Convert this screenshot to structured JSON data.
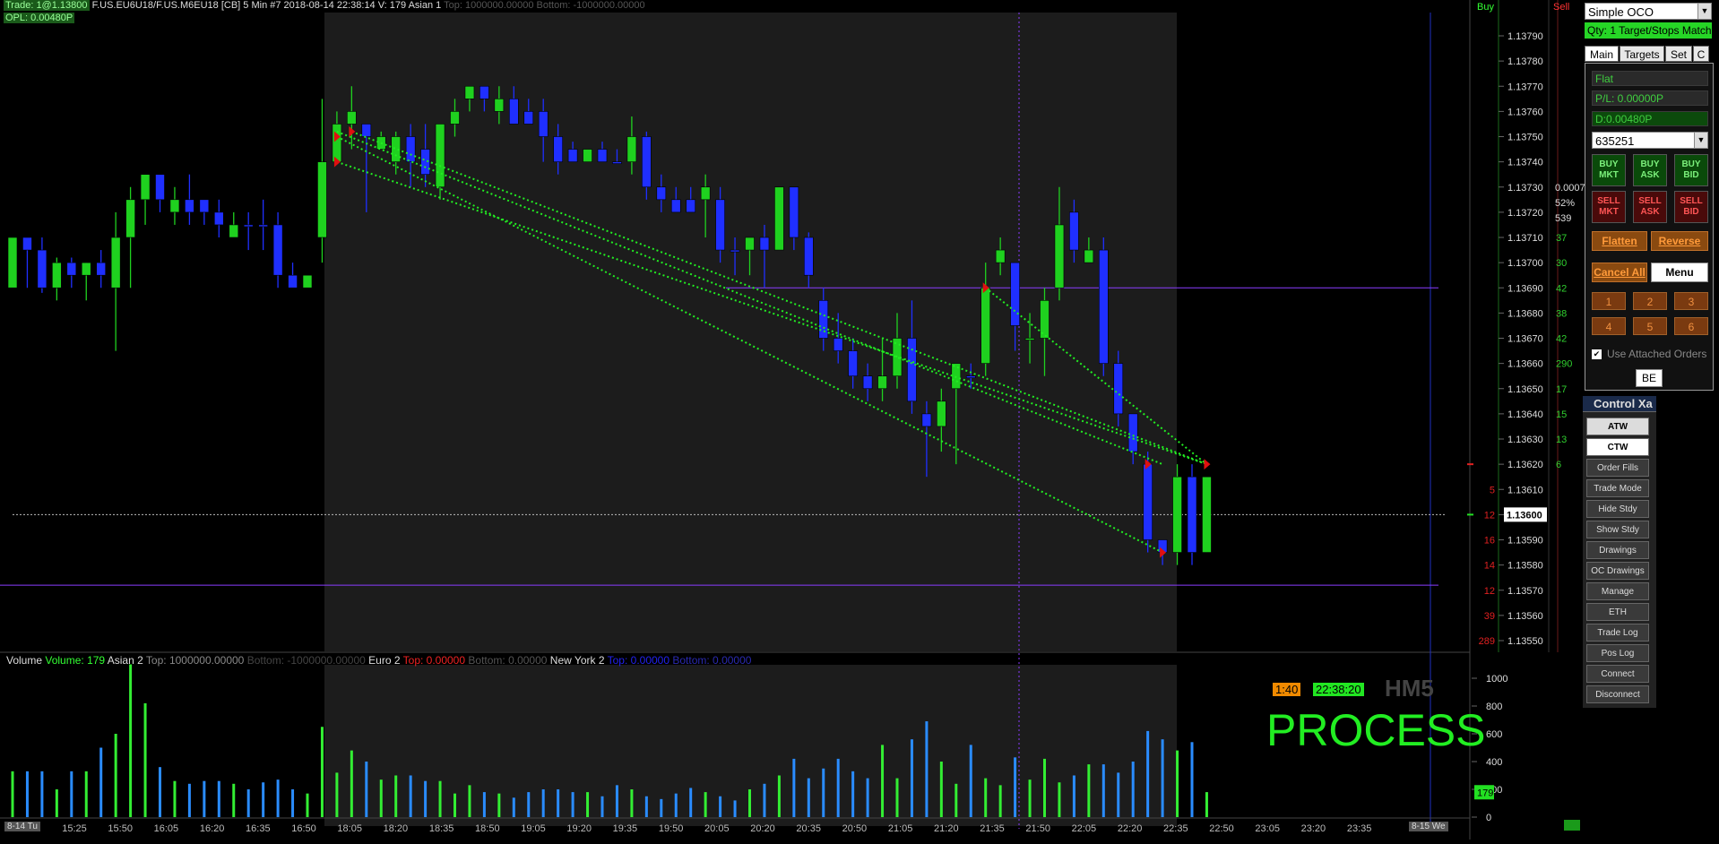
{
  "header": {
    "trade_label": "Trade: 1@1.13800",
    "symbol_info": "F.US.EU6U18/F.US.M6EU18 [CB]  5 Min   #7 2018-08-14 22:38:14 V: 179 Asian 1",
    "top_label": "Top: 1000000.00000",
    "bottom_label": "Bottom: -1000000.00000",
    "opl_label": "OPL: 0.00480P"
  },
  "price_axis": {
    "ticks": [
      "1.13790",
      "1.13780",
      "1.13770",
      "1.13760",
      "1.13750",
      "1.13740",
      "1.13730",
      "1.13720",
      "1.13710",
      "1.13700",
      "1.13690",
      "1.13680",
      "1.13670",
      "1.13660",
      "1.13650",
      "1.13640",
      "1.13630",
      "1.13620",
      "1.13610",
      "1.13600",
      "1.13590",
      "1.13580",
      "1.13570",
      "1.13560",
      "1.13550"
    ],
    "current_price": "1.13600"
  },
  "dom": {
    "buy_header": "Buy",
    "sell_header": "Sell",
    "bid_sizes": [
      "5",
      "12",
      "16",
      "14",
      "12",
      "39",
      "289"
    ],
    "ask_sizes": [
      "37",
      "30",
      "42",
      "38",
      "42",
      "290",
      "17",
      "15",
      "13",
      "6"
    ],
    "stats": [
      "0.0007",
      "52%",
      "539"
    ]
  },
  "volume_pane": {
    "label": "Volume",
    "volume_value": "Volume: 179",
    "asian2": "Asian 2",
    "asian2_top": "Top: 1000000.00000",
    "asian2_bottom": "Bottom: -1000000.00000",
    "euro2": "Euro 2",
    "euro2_top": "Top: 0.00000",
    "euro2_bottom": "Bottom: 0.00000",
    "ny2": "New York 2",
    "ny2_top": "Top: 0.00000",
    "ny2_bottom": "Bottom: 0.00000",
    "axis_ticks": [
      "1000",
      "800",
      "600",
      "400",
      "200",
      "0"
    ],
    "current_volume": "179",
    "timer": "1:40",
    "clock": "22:38:20",
    "bar_type": "HM5",
    "status_text": "PROCESS"
  },
  "time_axis": {
    "ticks": [
      "15:25",
      "15:50",
      "16:05",
      "16:20",
      "16:35",
      "16:50",
      "18:05",
      "18:20",
      "18:35",
      "18:50",
      "19:05",
      "19:20",
      "19:35",
      "19:50",
      "20:05",
      "20:20",
      "20:35",
      "20:50",
      "21:05",
      "21:20",
      "21:35",
      "21:50",
      "22:05",
      "22:20",
      "22:35",
      "22:50",
      "23:05",
      "23:20",
      "23:35"
    ],
    "left_date": "8-14 Tu",
    "right_date": "8-15 We"
  },
  "chart_data": {
    "type": "candlestick",
    "instrument": "F.US.EU6U18/F.US.M6EU18",
    "interval": "5 Min",
    "ylim": [
      1.13545,
      1.13795
    ],
    "candles": [
      {
        "o": 1.1369,
        "h": 1.1371,
        "l": 1.1369,
        "c": 1.1371,
        "col": "g"
      },
      {
        "o": 1.1371,
        "h": 1.1371,
        "l": 1.1369,
        "c": 1.13705,
        "col": "b"
      },
      {
        "o": 1.13705,
        "h": 1.1371,
        "l": 1.13688,
        "c": 1.1369,
        "col": "b"
      },
      {
        "o": 1.1369,
        "h": 1.13702,
        "l": 1.13685,
        "c": 1.137,
        "col": "g"
      },
      {
        "o": 1.137,
        "h": 1.13702,
        "l": 1.1369,
        "c": 1.13695,
        "col": "b"
      },
      {
        "o": 1.13695,
        "h": 1.137,
        "l": 1.13685,
        "c": 1.137,
        "col": "g"
      },
      {
        "o": 1.137,
        "h": 1.13705,
        "l": 1.1369,
        "c": 1.13695,
        "col": "b"
      },
      {
        "o": 1.1369,
        "h": 1.1372,
        "l": 1.13665,
        "c": 1.1371,
        "col": "g"
      },
      {
        "o": 1.1371,
        "h": 1.1373,
        "l": 1.1369,
        "c": 1.13725,
        "col": "g"
      },
      {
        "o": 1.13725,
        "h": 1.13735,
        "l": 1.13715,
        "c": 1.13735,
        "col": "g"
      },
      {
        "o": 1.13735,
        "h": 1.13735,
        "l": 1.1372,
        "c": 1.13725,
        "col": "b"
      },
      {
        "o": 1.13725,
        "h": 1.1373,
        "l": 1.13715,
        "c": 1.1372,
        "col": "g"
      },
      {
        "o": 1.1372,
        "h": 1.13735,
        "l": 1.13715,
        "c": 1.13725,
        "col": "b"
      },
      {
        "o": 1.13725,
        "h": 1.13725,
        "l": 1.13715,
        "c": 1.1372,
        "col": "b"
      },
      {
        "o": 1.1372,
        "h": 1.13725,
        "l": 1.1371,
        "c": 1.13715,
        "col": "b"
      },
      {
        "o": 1.1371,
        "h": 1.1372,
        "l": 1.1371,
        "c": 1.13715,
        "col": "g"
      },
      {
        "o": 1.13715,
        "h": 1.1372,
        "l": 1.13705,
        "c": 1.13715,
        "col": "b"
      },
      {
        "o": 1.13715,
        "h": 1.13725,
        "l": 1.13705,
        "c": 1.13715,
        "col": "b"
      },
      {
        "o": 1.13715,
        "h": 1.1372,
        "l": 1.1369,
        "c": 1.13695,
        "col": "b"
      },
      {
        "o": 1.13695,
        "h": 1.137,
        "l": 1.1369,
        "c": 1.1369,
        "col": "b"
      },
      {
        "o": 1.1369,
        "h": 1.13695,
        "l": 1.1369,
        "c": 1.13695,
        "col": "g"
      },
      {
        "o": 1.1371,
        "h": 1.13765,
        "l": 1.137,
        "c": 1.1374,
        "col": "g"
      },
      {
        "o": 1.1374,
        "h": 1.1376,
        "l": 1.1374,
        "c": 1.13755,
        "col": "g"
      },
      {
        "o": 1.13755,
        "h": 1.1377,
        "l": 1.13745,
        "c": 1.1376,
        "col": "g"
      },
      {
        "o": 1.13755,
        "h": 1.13755,
        "l": 1.1372,
        "c": 1.1375,
        "col": "b"
      },
      {
        "o": 1.1375,
        "h": 1.13752,
        "l": 1.13745,
        "c": 1.13745,
        "col": "g"
      },
      {
        "o": 1.1374,
        "h": 1.13752,
        "l": 1.13735,
        "c": 1.1375,
        "col": "g"
      },
      {
        "o": 1.1375,
        "h": 1.13755,
        "l": 1.1373,
        "c": 1.1374,
        "col": "b"
      },
      {
        "o": 1.13735,
        "h": 1.13755,
        "l": 1.1373,
        "c": 1.13745,
        "col": "b"
      },
      {
        "o": 1.1373,
        "h": 1.13755,
        "l": 1.13725,
        "c": 1.13755,
        "col": "g"
      },
      {
        "o": 1.13755,
        "h": 1.13765,
        "l": 1.1375,
        "c": 1.1376,
        "col": "g"
      },
      {
        "o": 1.13765,
        "h": 1.1377,
        "l": 1.1376,
        "c": 1.1377,
        "col": "g"
      },
      {
        "o": 1.1377,
        "h": 1.1377,
        "l": 1.1376,
        "c": 1.13765,
        "col": "b"
      },
      {
        "o": 1.13765,
        "h": 1.1377,
        "l": 1.13755,
        "c": 1.1376,
        "col": "g"
      },
      {
        "o": 1.13765,
        "h": 1.1377,
        "l": 1.13755,
        "c": 1.13755,
        "col": "b"
      },
      {
        "o": 1.13755,
        "h": 1.13765,
        "l": 1.13755,
        "c": 1.1376,
        "col": "b"
      },
      {
        "o": 1.1376,
        "h": 1.13765,
        "l": 1.1374,
        "c": 1.1375,
        "col": "b"
      },
      {
        "o": 1.1375,
        "h": 1.13755,
        "l": 1.13735,
        "c": 1.1374,
        "col": "b"
      },
      {
        "o": 1.13745,
        "h": 1.13748,
        "l": 1.1374,
        "c": 1.1374,
        "col": "b"
      },
      {
        "o": 1.1374,
        "h": 1.13745,
        "l": 1.1374,
        "c": 1.13745,
        "col": "g"
      },
      {
        "o": 1.13745,
        "h": 1.13748,
        "l": 1.1374,
        "c": 1.1374,
        "col": "b"
      },
      {
        "o": 1.1374,
        "h": 1.13745,
        "l": 1.1374,
        "c": 1.1374,
        "col": "b"
      },
      {
        "o": 1.1374,
        "h": 1.13758,
        "l": 1.13735,
        "c": 1.1375,
        "col": "g"
      },
      {
        "o": 1.1375,
        "h": 1.13752,
        "l": 1.13725,
        "c": 1.1373,
        "col": "b"
      },
      {
        "o": 1.1373,
        "h": 1.13735,
        "l": 1.1372,
        "c": 1.13725,
        "col": "b"
      },
      {
        "o": 1.13725,
        "h": 1.1373,
        "l": 1.1372,
        "c": 1.1372,
        "col": "b"
      },
      {
        "o": 1.1372,
        "h": 1.1373,
        "l": 1.1372,
        "c": 1.13725,
        "col": "b"
      },
      {
        "o": 1.13725,
        "h": 1.13735,
        "l": 1.1371,
        "c": 1.1373,
        "col": "g"
      },
      {
        "o": 1.13725,
        "h": 1.1373,
        "l": 1.137,
        "c": 1.13705,
        "col": "b"
      },
      {
        "o": 1.13705,
        "h": 1.1371,
        "l": 1.13695,
        "c": 1.13705,
        "col": "b"
      },
      {
        "o": 1.13705,
        "h": 1.1371,
        "l": 1.13695,
        "c": 1.1371,
        "col": "g"
      },
      {
        "o": 1.1371,
        "h": 1.13715,
        "l": 1.1369,
        "c": 1.13705,
        "col": "b"
      },
      {
        "o": 1.13705,
        "h": 1.1373,
        "l": 1.13705,
        "c": 1.1373,
        "col": "g"
      },
      {
        "o": 1.1373,
        "h": 1.1373,
        "l": 1.13705,
        "c": 1.1371,
        "col": "b"
      },
      {
        "o": 1.1371,
        "h": 1.13712,
        "l": 1.1369,
        "c": 1.13695,
        "col": "b"
      },
      {
        "o": 1.13685,
        "h": 1.1369,
        "l": 1.13665,
        "c": 1.1367,
        "col": "b"
      },
      {
        "o": 1.1367,
        "h": 1.1368,
        "l": 1.1366,
        "c": 1.13665,
        "col": "b"
      },
      {
        "o": 1.13665,
        "h": 1.1367,
        "l": 1.1365,
        "c": 1.13655,
        "col": "b"
      },
      {
        "o": 1.13655,
        "h": 1.1366,
        "l": 1.13645,
        "c": 1.1365,
        "col": "b"
      },
      {
        "o": 1.1365,
        "h": 1.1367,
        "l": 1.13645,
        "c": 1.13655,
        "col": "g"
      },
      {
        "o": 1.13655,
        "h": 1.1368,
        "l": 1.1365,
        "c": 1.1367,
        "col": "g"
      },
      {
        "o": 1.1367,
        "h": 1.13685,
        "l": 1.1364,
        "c": 1.13645,
        "col": "b"
      },
      {
        "o": 1.1364,
        "h": 1.13645,
        "l": 1.13615,
        "c": 1.13635,
        "col": "b"
      },
      {
        "o": 1.13635,
        "h": 1.1365,
        "l": 1.13625,
        "c": 1.13645,
        "col": "g"
      },
      {
        "o": 1.1365,
        "h": 1.1366,
        "l": 1.1362,
        "c": 1.1366,
        "col": "g"
      },
      {
        "o": 1.13655,
        "h": 1.1366,
        "l": 1.1365,
        "c": 1.13655,
        "col": "b"
      },
      {
        "o": 1.1366,
        "h": 1.137,
        "l": 1.13655,
        "c": 1.1369,
        "col": "g"
      },
      {
        "o": 1.137,
        "h": 1.1371,
        "l": 1.13695,
        "c": 1.13705,
        "col": "g"
      },
      {
        "o": 1.137,
        "h": 1.137,
        "l": 1.13665,
        "c": 1.13675,
        "col": "b"
      },
      {
        "o": 1.1367,
        "h": 1.1368,
        "l": 1.1366,
        "c": 1.1367,
        "col": "g"
      },
      {
        "o": 1.1367,
        "h": 1.1369,
        "l": 1.13655,
        "c": 1.13685,
        "col": "g"
      },
      {
        "o": 1.1369,
        "h": 1.1373,
        "l": 1.13685,
        "c": 1.13715,
        "col": "g"
      },
      {
        "o": 1.1372,
        "h": 1.13725,
        "l": 1.137,
        "c": 1.13705,
        "col": "b"
      },
      {
        "o": 1.13705,
        "h": 1.1371,
        "l": 1.137,
        "c": 1.137,
        "col": "g"
      },
      {
        "o": 1.13705,
        "h": 1.1371,
        "l": 1.13655,
        "c": 1.1366,
        "col": "b"
      },
      {
        "o": 1.1366,
        "h": 1.13665,
        "l": 1.13635,
        "c": 1.1364,
        "col": "b"
      },
      {
        "o": 1.1364,
        "h": 1.1364,
        "l": 1.1362,
        "c": 1.13625,
        "col": "b"
      },
      {
        "o": 1.1362,
        "h": 1.13625,
        "l": 1.13585,
        "c": 1.1359,
        "col": "b"
      },
      {
        "o": 1.1359,
        "h": 1.1359,
        "l": 1.1358,
        "c": 1.13585,
        "col": "b"
      },
      {
        "o": 1.13585,
        "h": 1.1362,
        "l": 1.1358,
        "c": 1.13615,
        "col": "g"
      },
      {
        "o": 1.13615,
        "h": 1.1362,
        "l": 1.1358,
        "c": 1.13585,
        "col": "b"
      },
      {
        "o": 1.13585,
        "h": 1.13615,
        "l": 1.13585,
        "c": 1.13615,
        "col": "g"
      }
    ],
    "volume": [
      330,
      330,
      330,
      200,
      330,
      330,
      500,
      600,
      1100,
      820,
      360,
      260,
      240,
      260,
      260,
      240,
      200,
      250,
      270,
      200,
      170,
      650,
      320,
      480,
      400,
      270,
      300,
      300,
      260,
      260,
      170,
      230,
      180,
      170,
      140,
      180,
      200,
      200,
      180,
      180,
      150,
      230,
      200,
      150,
      130,
      170,
      210,
      180,
      150,
      120,
      200,
      240,
      300,
      420,
      280,
      350,
      420,
      330,
      280,
      520,
      280,
      560,
      690,
      400,
      240,
      520,
      280,
      230,
      430,
      270,
      420,
      250,
      300,
      380,
      380,
      320,
      400,
      620,
      560,
      480,
      540,
      180
    ],
    "levels": {
      "support_line": 1.13572,
      "resistance_line": 1.1369,
      "last_price": 1.136
    }
  },
  "order_panel": {
    "strategy": "Simple OCO",
    "qty_label": "Qty: 1 Target/Stops Match",
    "tabs": [
      "Main",
      "Targets",
      "Set",
      "C"
    ],
    "position": "Flat",
    "pl": "P/L: 0.00000P",
    "d": "D:0.00480P",
    "account": "635251",
    "buy_buttons": [
      [
        "BUY",
        "MKT"
      ],
      [
        "BUY",
        "ASK"
      ],
      [
        "BUY",
        "BID"
      ]
    ],
    "sell_buttons": [
      [
        "SELL",
        "MKT"
      ],
      [
        "SELL",
        "ASK"
      ],
      [
        "SELL",
        "BID"
      ]
    ],
    "flatten": "Flatten",
    "reverse": "Reverse",
    "cancel_all": "Cancel All",
    "menu": "Menu",
    "qty_buttons": [
      "1",
      "2",
      "3",
      "4",
      "5",
      "6"
    ],
    "use_attached": "Use Attached Orders",
    "be": "BE",
    "control_title": "Control Xa",
    "control_buttons": [
      "ATW",
      "CTW",
      "Order Fills",
      "Trade Mode",
      "Hide Stdy",
      "Show Stdy",
      "Drawings",
      "OC Drawings",
      "Manage",
      "ETH",
      "Trade Log",
      "Pos Log",
      "Connect",
      "Disconnect"
    ]
  },
  "colors": {
    "up_candle": "#1fd11f",
    "down_candle": "#1f2fff",
    "trendline": "#22ee22",
    "level_line": "#8a3cff",
    "session_bg": "#1c1c1c",
    "volume_up": "#33ee33",
    "volume_down": "#2a8cff"
  }
}
